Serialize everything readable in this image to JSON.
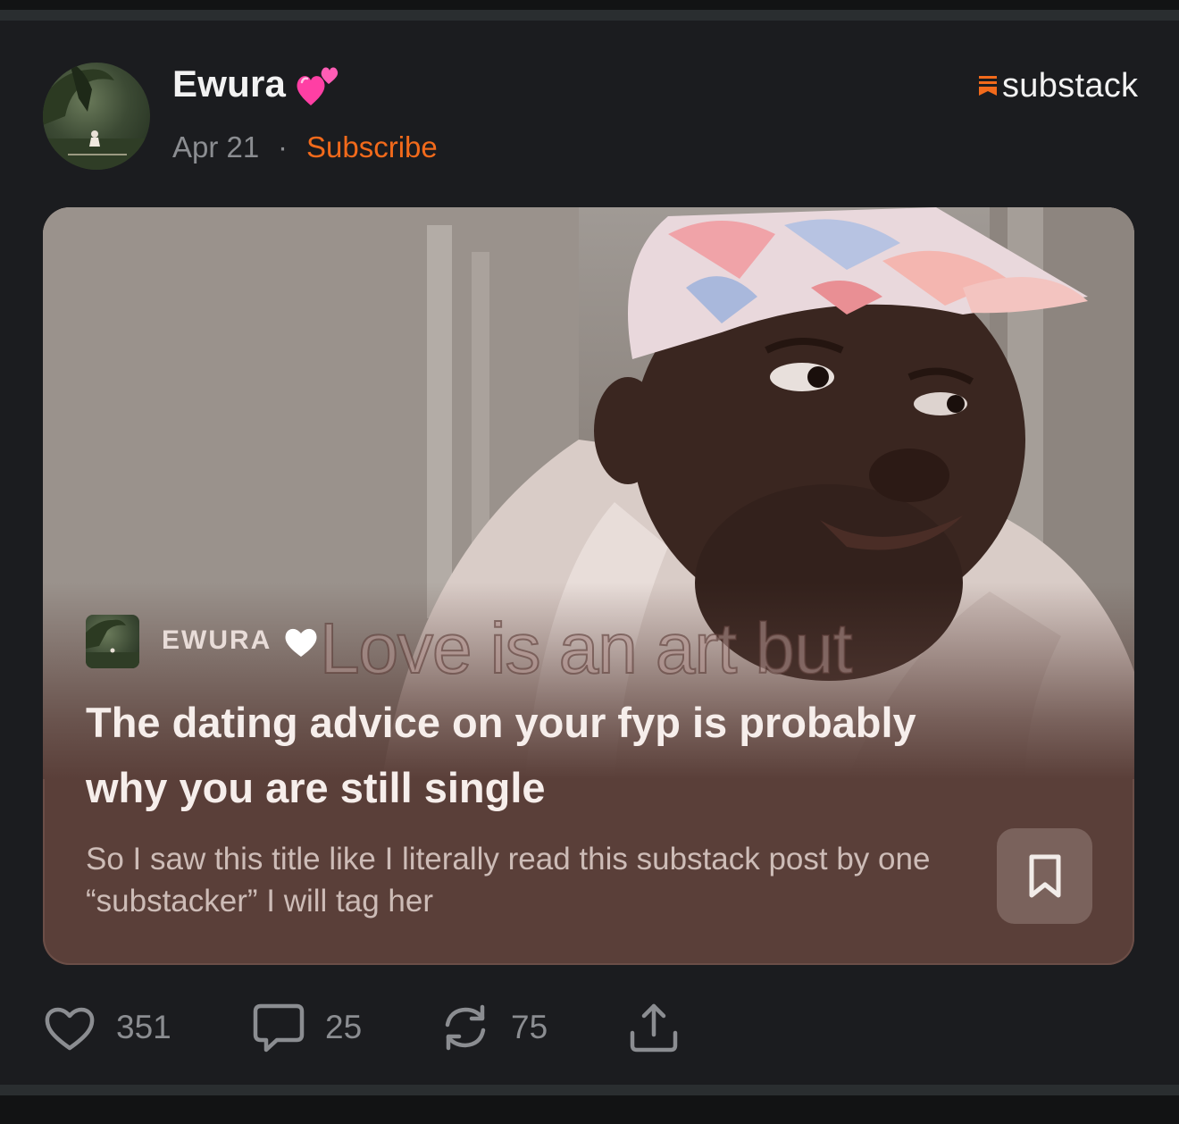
{
  "post": {
    "author_name": "Ewura",
    "date": "Apr 21",
    "separator": "·",
    "subscribe_label": "Subscribe",
    "brand": "substack"
  },
  "card": {
    "publication_name": "EWURA",
    "image_overlay_text": "Love is an art but",
    "title": "The dating advice on your fyp is probably why you are still single",
    "excerpt": "So I saw this title like I literally read this substack post by one “substacker” I will tag her"
  },
  "actions": {
    "likes": "351",
    "comments": "25",
    "restacks": "75"
  },
  "icons": {
    "author_badge": "two-hearts-icon",
    "publication_badge": "white-heart-icon",
    "brand": "substack-logo-icon",
    "bookmark": "bookmark-icon",
    "like": "heart-icon",
    "comment": "comment-bubble-icon",
    "restack": "restack-icon",
    "share": "share-icon"
  },
  "colors": {
    "background": "#1b1c1f",
    "accent": "#f26a1b",
    "card": "#5a3f39",
    "muted": "#8b8d91"
  }
}
